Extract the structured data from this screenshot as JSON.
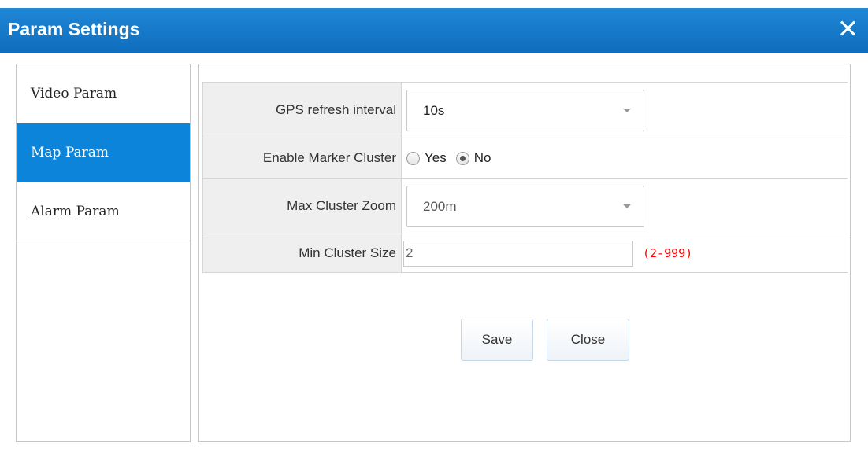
{
  "window": {
    "title": "Param Settings"
  },
  "sidebar": {
    "items": [
      {
        "label": "Video Param"
      },
      {
        "label": "Map Param",
        "active": true
      },
      {
        "label": "Alarm Param"
      }
    ]
  },
  "form": {
    "gps_refresh": {
      "label": "GPS refresh interval",
      "value": "10s"
    },
    "marker_cluster": {
      "label": "Enable Marker Cluster",
      "options": [
        "Yes",
        "No"
      ],
      "selected": "No"
    },
    "max_cluster_zoom": {
      "label": "Max Cluster Zoom",
      "value": "200m"
    },
    "min_cluster_size": {
      "label": "Min Cluster Size",
      "value": "2",
      "hint": "(2-999)"
    }
  },
  "actions": {
    "save_label": "Save",
    "close_label": "Close"
  },
  "colors": {
    "titlebar": "#1479cb",
    "active_tab": "#0b84da",
    "hint": "#ff0000"
  },
  "icons": {
    "close": "close-icon",
    "dropdown": "chevron-down-icon"
  }
}
